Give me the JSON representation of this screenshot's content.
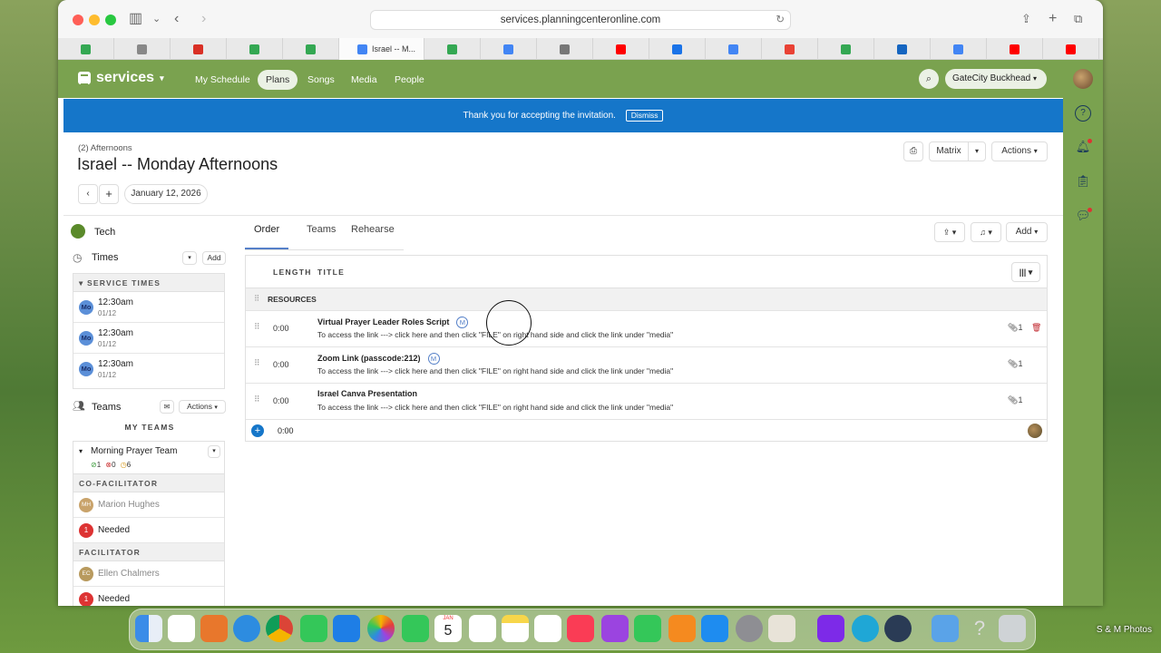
{
  "browser": {
    "url": "services.planningcenteronline.com",
    "active_tab_label": "Israel -- M...",
    "tab_favicon_colors": [
      "#34a853",
      "#888888",
      "#d93025",
      "#34a853",
      "#34a853",
      "#4285f4",
      "#34a853",
      "#4285f4",
      "#777777",
      "#ff0000",
      "#1a73e8",
      "#4285f4",
      "#e94235",
      "#34a853",
      "#1565c0",
      "#4285f4",
      "#ff0000",
      "#ff0000",
      "#ff0000"
    ]
  },
  "app": {
    "brand": "services",
    "nav": [
      "My Schedule",
      "Plans",
      "Songs",
      "Media",
      "People"
    ],
    "active_nav": "Plans",
    "org": "GateCity Buckhead",
    "accent_color": "#7aa24f"
  },
  "banner": {
    "text": "Thank you for accepting the invitation.",
    "dismiss": "Dismiss",
    "color": "#1576c9"
  },
  "plan": {
    "breadcrumb": "(2) Afternoons",
    "title": "Israel -- Monday Afternoons",
    "date": "January 12, 2026",
    "matrix_label": "Matrix",
    "actions_label": "Actions"
  },
  "sidebar": {
    "tech_label": "Tech",
    "times_label": "Times",
    "add_label": "Add",
    "service_times_header": "SERVICE TIMES",
    "service_times": [
      {
        "day": "Mo",
        "time": "12:30am",
        "date": "01/12"
      },
      {
        "day": "Mo",
        "time": "12:30am",
        "date": "01/12"
      },
      {
        "day": "Mo",
        "time": "12:30am",
        "date": "01/12"
      }
    ],
    "teams_label": "Teams",
    "teams_actions": "Actions",
    "my_teams_header": "MY TEAMS",
    "team_name": "Morning Prayer Team",
    "counts": {
      "confirmed": "1",
      "declined": "0",
      "pending": "6"
    },
    "positions": [
      {
        "header": "CO-FACILITATOR",
        "person": "Marion Hughes",
        "initials": "MH",
        "needed_count": "1",
        "needed_label": "Needed"
      },
      {
        "header": "FACILITATOR",
        "person": "Ellen Chalmers",
        "initials": "EC",
        "needed_count": "1",
        "needed_label": "Needed"
      }
    ]
  },
  "order": {
    "tabs": [
      "Order",
      "Teams",
      "Rehearse"
    ],
    "active_tab": "Order",
    "add_label": "Add",
    "columns": {
      "length": "LENGTH",
      "title": "TITLE"
    },
    "section": "RESOURCES",
    "items": [
      {
        "length": "0:00",
        "title": "Virtual Prayer Leader Roles Script",
        "badge": "M",
        "desc": "To access the link ---> click here and then click \"FILE\" on right hand side and click the link under \"media\"",
        "attachments": "1",
        "deletable": true
      },
      {
        "length": "0:00",
        "title": "Zoom Link (passcode:212)",
        "badge": "M",
        "desc": "To access the link ---> click here and then click \"FILE\" on right hand side and click the link under \"media\"",
        "attachments": "1",
        "deletable": false
      },
      {
        "length": "0:00",
        "title": "Israel Canva Presentation",
        "badge": "",
        "desc": "To access the link ---> click here and then click \"FILE\" on right hand side and click the link under \"media\"",
        "attachments": "1",
        "deletable": false
      }
    ],
    "total_length": "0:00"
  },
  "dock": {
    "calendar_month": "JAN",
    "calendar_day": "5",
    "desktop_label": "S & M Photos"
  }
}
